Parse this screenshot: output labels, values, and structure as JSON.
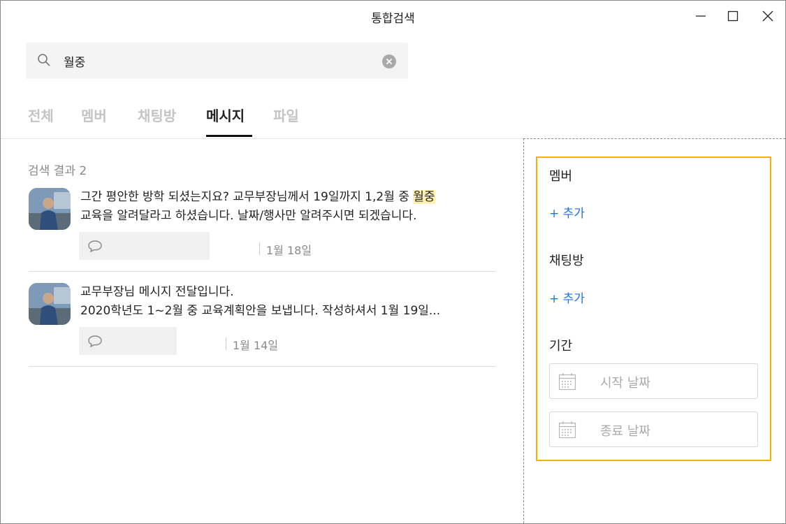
{
  "window": {
    "title": "통합검색"
  },
  "search": {
    "value": "월중"
  },
  "tabs": [
    {
      "label": "전체",
      "active": false
    },
    {
      "label": "멤버",
      "active": false
    },
    {
      "label": "채팅방",
      "active": false
    },
    {
      "label": "메시지",
      "active": true
    },
    {
      "label": "파일",
      "active": false
    }
  ],
  "results": {
    "count_label": "검색 결과 2",
    "items": [
      {
        "line1_before": "그간 평안한 방학 되셨는지요? 교무부장님께서 19일까지 1,2월 중 ",
        "line1_highlight": "월중",
        "line2": "교육을 알려달라고 하셨습니다. 날짜/행사만 알려주시면 되겠습니다.",
        "date": "1월 18일"
      },
      {
        "line1": "교무부장님 메시지 전달입니다.",
        "line2": "2020학년도 1~2월 중 교육계획안을 보냅니다. 작성하셔서 1월 19일...",
        "date": "1월 14일"
      }
    ]
  },
  "filters": {
    "member_label": "멤버",
    "member_add": "+ 추가",
    "chatroom_label": "채팅방",
    "chatroom_add": "+ 추가",
    "period_label": "기간",
    "start_placeholder": "시작 날짜",
    "end_placeholder": "종료 날짜"
  },
  "colors": {
    "highlight": "#fff2b3",
    "link": "#1a73e8",
    "filter_border": "#f0b400"
  }
}
